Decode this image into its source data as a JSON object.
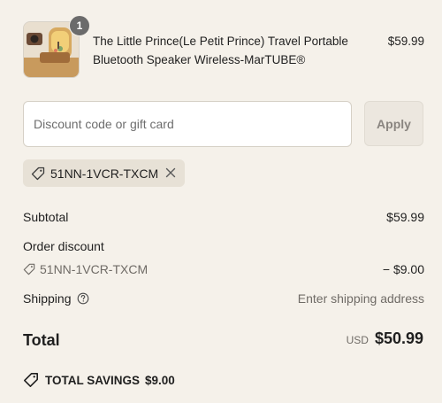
{
  "product": {
    "quantity": "1",
    "name": "The Little Prince(Le Petit Prince) Travel Portable Bluetooth Speaker Wireless-MarTUBE®",
    "price": "$59.99"
  },
  "discount": {
    "placeholder": "Discount code or gift card",
    "value": "",
    "apply_label": "Apply",
    "applied_code": "51NN-1VCR-TXCM"
  },
  "summary": {
    "subtotal_label": "Subtotal",
    "subtotal_value": "$59.99",
    "order_discount_label": "Order discount",
    "discount_code": "51NN-1VCR-TXCM",
    "discount_value": "− $9.00",
    "shipping_label": "Shipping",
    "shipping_value": "Enter shipping address",
    "total_label": "Total",
    "currency": "USD",
    "total_value": "$50.99",
    "savings_label": "TOTAL SAVINGS",
    "savings_value": "$9.00"
  },
  "icons": {
    "tag": "tag-icon",
    "remove": "close-icon",
    "help": "question-circle-icon",
    "savings": "tag-icon"
  },
  "colors": {
    "background": "#f5f1ea",
    "chip": "#e7e1d6",
    "badge": "#6b6b6b",
    "text": "#1f1f1f",
    "muted_text": "#6f6b66"
  }
}
